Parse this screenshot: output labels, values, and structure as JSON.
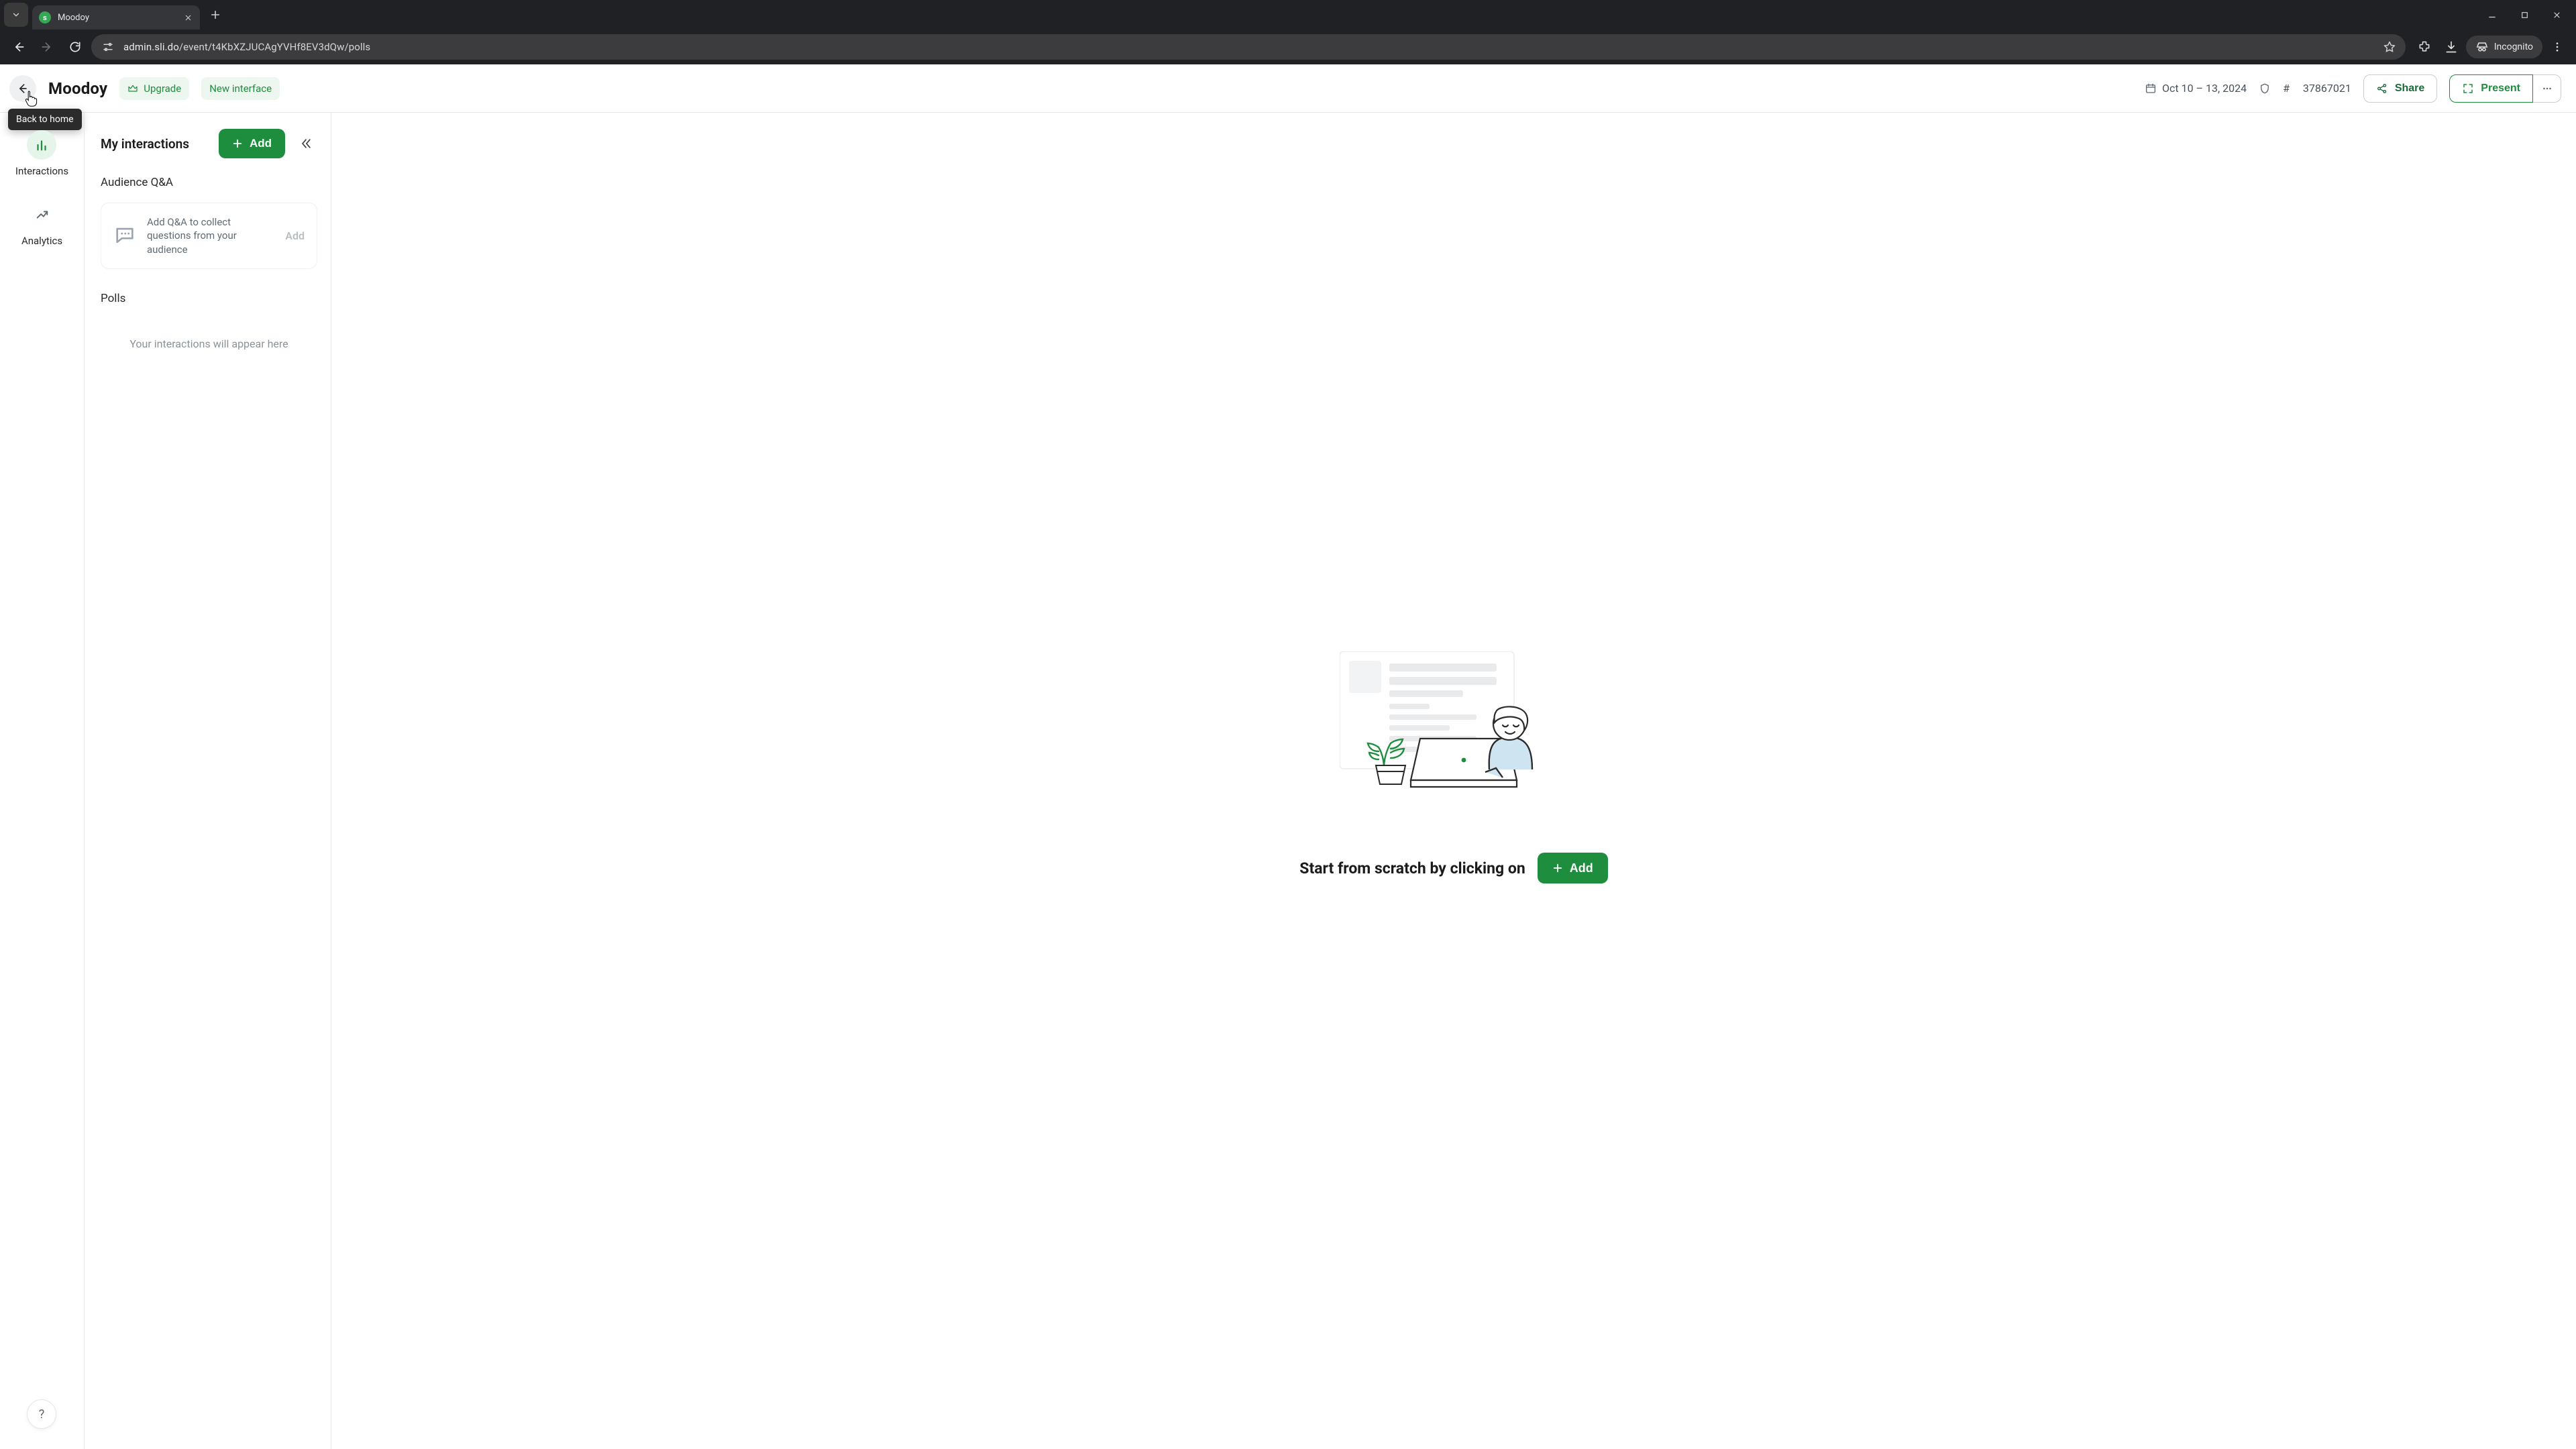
{
  "browser": {
    "tab_title": "Moodoy",
    "favicon_letter": "s",
    "url_host": "admin.sli.do",
    "url_path": "/event/t4KbXZJUCAgYVHf8EV3dQw/polls",
    "incognito_label": "Incognito"
  },
  "topbar": {
    "back_tooltip": "Back to home",
    "title": "Moodoy",
    "upgrade_label": "Upgrade",
    "new_interface_label": "New interface",
    "date_range": "Oct 10 – 13, 2024",
    "event_code_prefix": "#",
    "event_code": "37867021",
    "share_label": "Share",
    "present_label": "Present"
  },
  "sidebar": {
    "items": [
      {
        "label": "Interactions"
      },
      {
        "label": "Analytics"
      }
    ],
    "help_label": "?"
  },
  "panel": {
    "title": "My interactions",
    "add_label": "Add",
    "qa_section_label": "Audience Q&A",
    "qa_card_text": "Add Q&A to collect questions from your audience",
    "qa_card_add": "Add",
    "polls_section_label": "Polls",
    "empty_hint": "Your interactions will appear here"
  },
  "main": {
    "cta_text": "Start from scratch by clicking on",
    "cta_add_label": "Add"
  },
  "colors": {
    "brand_green": "#1e8e3e",
    "soft_green_bg": "#eef6f0"
  }
}
